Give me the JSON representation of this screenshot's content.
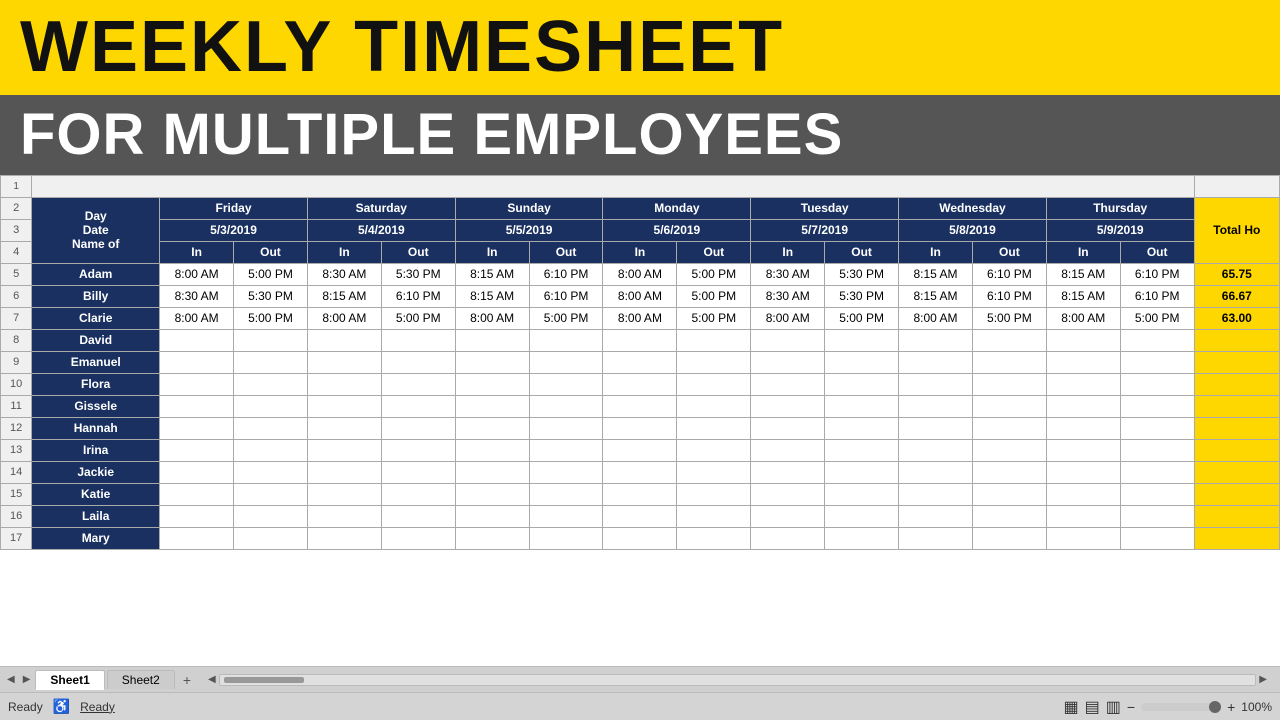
{
  "header": {
    "line1": "WEEKLY TIMESHEET",
    "line2": "FOR MULTIPLE EMPLOYEES"
  },
  "spreadsheet": {
    "row1_label": "1",
    "columns": {
      "rowNums": [
        "1",
        "2",
        "3",
        "4",
        "5",
        "6",
        "7",
        "8",
        "9",
        "10",
        "11",
        "12",
        "13",
        "14",
        "15",
        "16",
        "17"
      ],
      "headers": {
        "row2": {
          "nameLabel": "Day",
          "days": [
            "Friday",
            "Saturday",
            "Sunday",
            "Monday",
            "Tuesday",
            "Wednesday",
            "Thursday"
          ],
          "totalLabel": "Total Ho"
        },
        "row3": {
          "nameLabel": "Date",
          "dates": [
            "5/3/2019",
            "5/4/2019",
            "5/5/2019",
            "5/6/2019",
            "5/7/2019",
            "5/8/2019",
            "5/9/2019"
          ]
        },
        "row4": {
          "nameLabel": "Name of",
          "inout": [
            "In",
            "Out",
            "In",
            "Out",
            "In",
            "Out",
            "In",
            "Out",
            "In",
            "Out",
            "In",
            "Out",
            "In",
            "Out"
          ]
        }
      }
    },
    "employees": [
      {
        "name": "Adam",
        "times": [
          "8:00 AM",
          "5:00 PM",
          "8:30 AM",
          "5:30 PM",
          "8:15 AM",
          "6:10 PM",
          "8:00 AM",
          "5:00 PM",
          "8:30 AM",
          "5:30 PM",
          "8:15 AM",
          "6:10 PM",
          "8:15 AM",
          "6:10 PM"
        ],
        "total": "65.75"
      },
      {
        "name": "Billy",
        "times": [
          "8:30 AM",
          "5:30 PM",
          "8:15 AM",
          "6:10 PM",
          "8:15 AM",
          "6:10 PM",
          "8:00 AM",
          "5:00 PM",
          "8:30 AM",
          "5:30 PM",
          "8:15 AM",
          "6:10 PM",
          "8:15 AM",
          "6:10 PM"
        ],
        "total": "66.67"
      },
      {
        "name": "Clarie",
        "times": [
          "8:00 AM",
          "5:00 PM",
          "8:00 AM",
          "5:00 PM",
          "8:00 AM",
          "5:00 PM",
          "8:00 AM",
          "5:00 PM",
          "8:00 AM",
          "5:00 PM",
          "8:00 AM",
          "5:00 PM",
          "8:00 AM",
          "5:00 PM"
        ],
        "total": "63.00"
      },
      {
        "name": "David",
        "times": [],
        "total": ""
      },
      {
        "name": "Emanuel",
        "times": [],
        "total": ""
      },
      {
        "name": "Flora",
        "times": [],
        "total": ""
      },
      {
        "name": "Gissele",
        "times": [],
        "total": ""
      },
      {
        "name": "Hannah",
        "times": [],
        "total": ""
      },
      {
        "name": "Irina",
        "times": [],
        "total": ""
      },
      {
        "name": "Jackie",
        "times": [],
        "total": ""
      },
      {
        "name": "Katie",
        "times": [],
        "total": ""
      },
      {
        "name": "Laila",
        "times": [],
        "total": ""
      },
      {
        "name": "Mary",
        "times": [],
        "total": ""
      }
    ],
    "sheets": [
      "Sheet1",
      "Sheet2"
    ],
    "activeSheet": "Sheet1",
    "statusLeft": "Ready",
    "statusRight": "100%"
  },
  "icons": {
    "accessibility": "♿",
    "grid1": "▦",
    "grid2": "▤",
    "grid3": "▥",
    "zoomMinus": "−",
    "zoomPlus": "+",
    "scrollLeft": "◀",
    "scrollRight": "▶",
    "addSheet": "+"
  }
}
